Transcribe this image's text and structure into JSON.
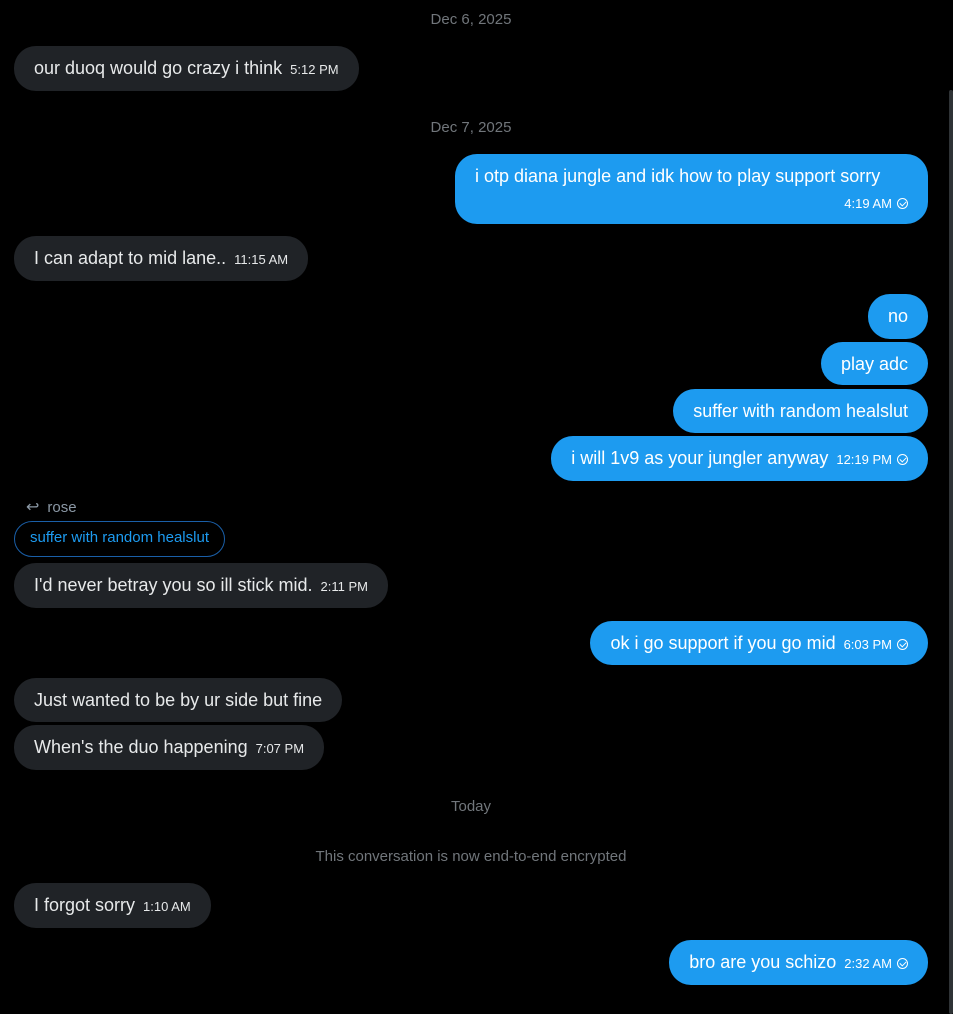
{
  "dates": {
    "d1": "Dec 6, 2025",
    "d2": "Dec 7, 2025",
    "d3": "Today"
  },
  "notice": "This conversation is now end-to-end encrypted",
  "messages": [
    {
      "text": "our duoq would go crazy i think",
      "time": "5:12 PM"
    },
    {
      "text": "i otp diana jungle and idk how to play support sorry",
      "time": "4:19 AM"
    },
    {
      "text": "I can adapt to mid lane..",
      "time": "11:15 AM"
    },
    {
      "text": "no"
    },
    {
      "text": "play adc"
    },
    {
      "text": "suffer with random healslut"
    },
    {
      "text": "i will 1v9 as your jungler anyway",
      "time": "12:19 PM"
    },
    {
      "text": "I'd never betray you  so ill stick mid.",
      "time": "2:11 PM"
    },
    {
      "text": "ok i go support if you go mid",
      "time": "6:03 PM"
    },
    {
      "text": "Just wanted to be by ur side but fine"
    },
    {
      "text": "When's the duo happening",
      "time": "7:07 PM"
    },
    {
      "text": "I forgot sorry",
      "time": "1:10 AM"
    },
    {
      "text": "bro are you schizo",
      "time": "2:32 AM"
    }
  ],
  "reply": {
    "author": "rose",
    "quoted": "suffer with random healslut"
  }
}
